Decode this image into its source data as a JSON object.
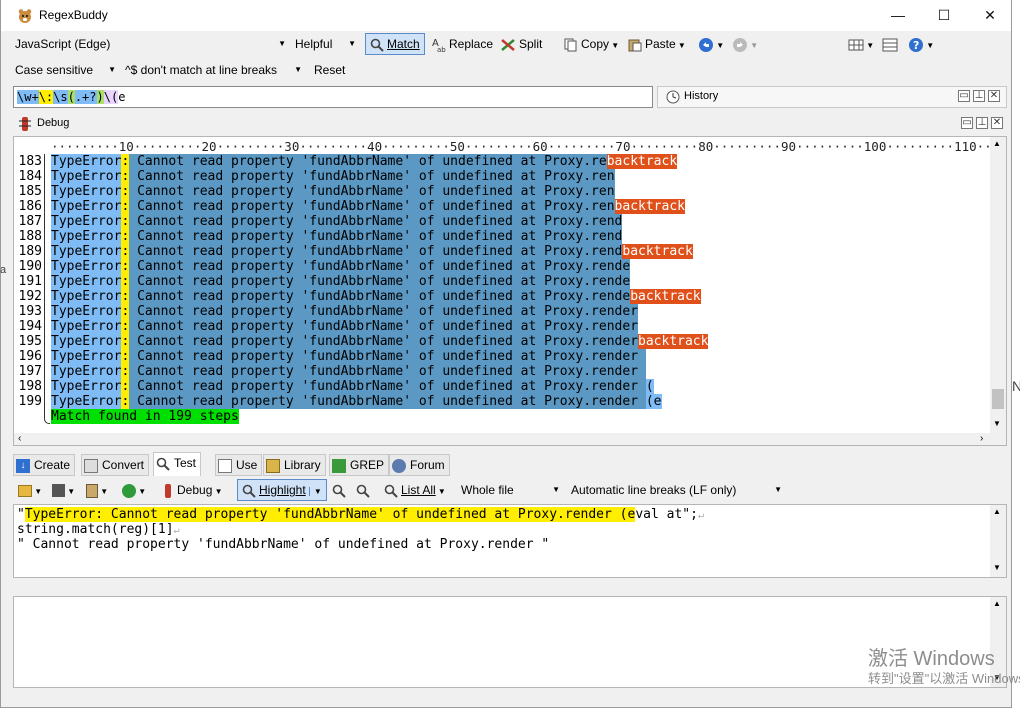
{
  "window": {
    "title": "RegexBuddy",
    "min_icon": "minimize-icon",
    "max_icon": "maximize-icon",
    "close_icon": "close-icon"
  },
  "toolbar1": {
    "flavor": "JavaScript (Edge)",
    "helpful": "Helpful",
    "match": "Match",
    "replace": "Replace",
    "split": "Split",
    "copy": "Copy",
    "paste": "Paste"
  },
  "toolbar2": {
    "case": "Case sensitive",
    "linebreaks": "^$ don't match at line breaks",
    "reset": "Reset"
  },
  "regex": {
    "t1": "\\w+",
    "t2": "\\:",
    "t3": "\\s",
    "t4": "(",
    "t5": ".+?",
    "t6": ")",
    "t7": "\\(",
    "t8": "e"
  },
  "history": {
    "label": "History"
  },
  "debug": {
    "label": "Debug",
    "ruler": "·········10·········20·········30·········40·········50·········60·········70·········80·········90·········100·········110·····",
    "rows": [
      {
        "n": "183",
        "w": "TypeError",
        "c": ":",
        "body": " Cannot read property 'fundAbbrName' of undefined at Proxy.re",
        "tail": "",
        "bt": "backtrack"
      },
      {
        "n": "184",
        "w": "TypeError",
        "c": ":",
        "body": " Cannot read property 'fundAbbrName' of undefined at Proxy.ren",
        "tail": "",
        "bt": ""
      },
      {
        "n": "185",
        "w": "TypeError",
        "c": ":",
        "body": " Cannot read property 'fundAbbrName' of undefined at Proxy.ren",
        "tail": "",
        "bt": ""
      },
      {
        "n": "186",
        "w": "TypeError",
        "c": ":",
        "body": " Cannot read property 'fundAbbrName' of undefined at Proxy.ren",
        "tail": "",
        "bt": "backtrack"
      },
      {
        "n": "187",
        "w": "TypeError",
        "c": ":",
        "body": " Cannot read property 'fundAbbrName' of undefined at Proxy.rend",
        "tail": "",
        "bt": ""
      },
      {
        "n": "188",
        "w": "TypeError",
        "c": ":",
        "body": " Cannot read property 'fundAbbrName' of undefined at Proxy.rend",
        "tail": "",
        "bt": ""
      },
      {
        "n": "189",
        "w": "TypeError",
        "c": ":",
        "body": " Cannot read property 'fundAbbrName' of undefined at Proxy.rend",
        "tail": "",
        "bt": "backtrack"
      },
      {
        "n": "190",
        "w": "TypeError",
        "c": ":",
        "body": " Cannot read property 'fundAbbrName' of undefined at Proxy.rende",
        "tail": "",
        "bt": ""
      },
      {
        "n": "191",
        "w": "TypeError",
        "c": ":",
        "body": " Cannot read property 'fundAbbrName' of undefined at Proxy.rende",
        "tail": "",
        "bt": ""
      },
      {
        "n": "192",
        "w": "TypeError",
        "c": ":",
        "body": " Cannot read property 'fundAbbrName' of undefined at Proxy.rende",
        "tail": "",
        "bt": "backtrack"
      },
      {
        "n": "193",
        "w": "TypeError",
        "c": ":",
        "body": " Cannot read property 'fundAbbrName' of undefined at Proxy.render",
        "tail": "",
        "bt": ""
      },
      {
        "n": "194",
        "w": "TypeError",
        "c": ":",
        "body": " Cannot read property 'fundAbbrName' of undefined at Proxy.render",
        "tail": "",
        "bt": ""
      },
      {
        "n": "195",
        "w": "TypeError",
        "c": ":",
        "body": " Cannot read property 'fundAbbrName' of undefined at Proxy.render",
        "tail": "",
        "bt": "backtrack"
      },
      {
        "n": "196",
        "w": "TypeError",
        "c": ":",
        "body": " Cannot read property 'fundAbbrName' of undefined at Proxy.render ",
        "tail": "",
        "bt": ""
      },
      {
        "n": "197",
        "w": "TypeError",
        "c": ":",
        "body": " Cannot read property 'fundAbbrName' of undefined at Proxy.render ",
        "tail": "",
        "bt": ""
      },
      {
        "n": "198",
        "w": "TypeError",
        "c": ":",
        "body": " Cannot read property 'fundAbbrName' of undefined at Proxy.render ",
        "tail": "(",
        "bt": ""
      },
      {
        "n": "199",
        "w": "TypeError",
        "c": ":",
        "body": " Cannot read property 'fundAbbrName' of undefined at Proxy.render ",
        "tail": "(e",
        "bt": ""
      }
    ],
    "found": "Match found in 199 steps"
  },
  "tabs": [
    {
      "label": "Create",
      "icon": "create-icon"
    },
    {
      "label": "Convert",
      "icon": "convert-icon"
    },
    {
      "label": "Test",
      "icon": "test-icon"
    },
    {
      "label": "Use",
      "icon": "use-icon"
    },
    {
      "label": "Library",
      "icon": "library-icon"
    },
    {
      "label": "GREP",
      "icon": "grep-icon"
    },
    {
      "label": "Forum",
      "icon": "forum-icon"
    }
  ],
  "test_toolbar": {
    "debug": "Debug",
    "highlight": "Highlight",
    "list_all": "List All",
    "scope": "Whole file",
    "linebreaks": "Automatic line breaks (LF only)"
  },
  "test": {
    "q": "\"",
    "match": "TypeError: Cannot read property 'fundAbbrName' of undefined at Proxy.render (e",
    "rest": "val at\";",
    "line2": "string.match(reg)[1]",
    "line3": "\" Cannot read property 'fundAbbrName' of undefined at Proxy.render \""
  },
  "watermark": {
    "line1": "激活 Windows",
    "line2": "转到\"设置\"以激活 Windows。"
  },
  "colors": {
    "match_blue": "#7fbcf5",
    "group_blue": "#5b99c4",
    "colon_yellow": "#ffee00",
    "backtrack": "#e0501a",
    "found": "#00e000"
  }
}
